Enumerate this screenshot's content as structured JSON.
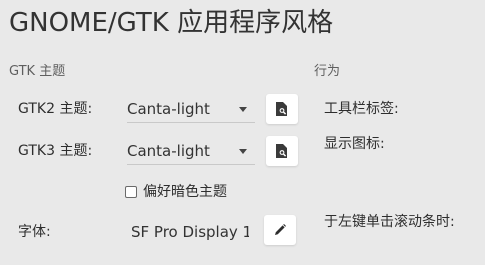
{
  "page": {
    "title": "GNOME/GTK 应用程序风格"
  },
  "gtk_section": {
    "title": "GTK 主题",
    "gtk2": {
      "label": "GTK2 主题:",
      "value": "Canta-light"
    },
    "gtk3": {
      "label": "GTK3 主题:",
      "value": "Canta-light"
    },
    "prefer_dark": {
      "label": "偏好暗色主题",
      "checked": false
    },
    "font": {
      "label": "字体:",
      "value": "SF Pro Display 1"
    }
  },
  "behavior_section": {
    "title": "行为",
    "toolbar_labels": "工具栏标签:",
    "show_icons": "显示图标:",
    "left_click_scrollbar": "于左键单击滚动条时:"
  },
  "icons": {
    "browse": "folder-search-icon",
    "edit": "pencil-icon"
  }
}
